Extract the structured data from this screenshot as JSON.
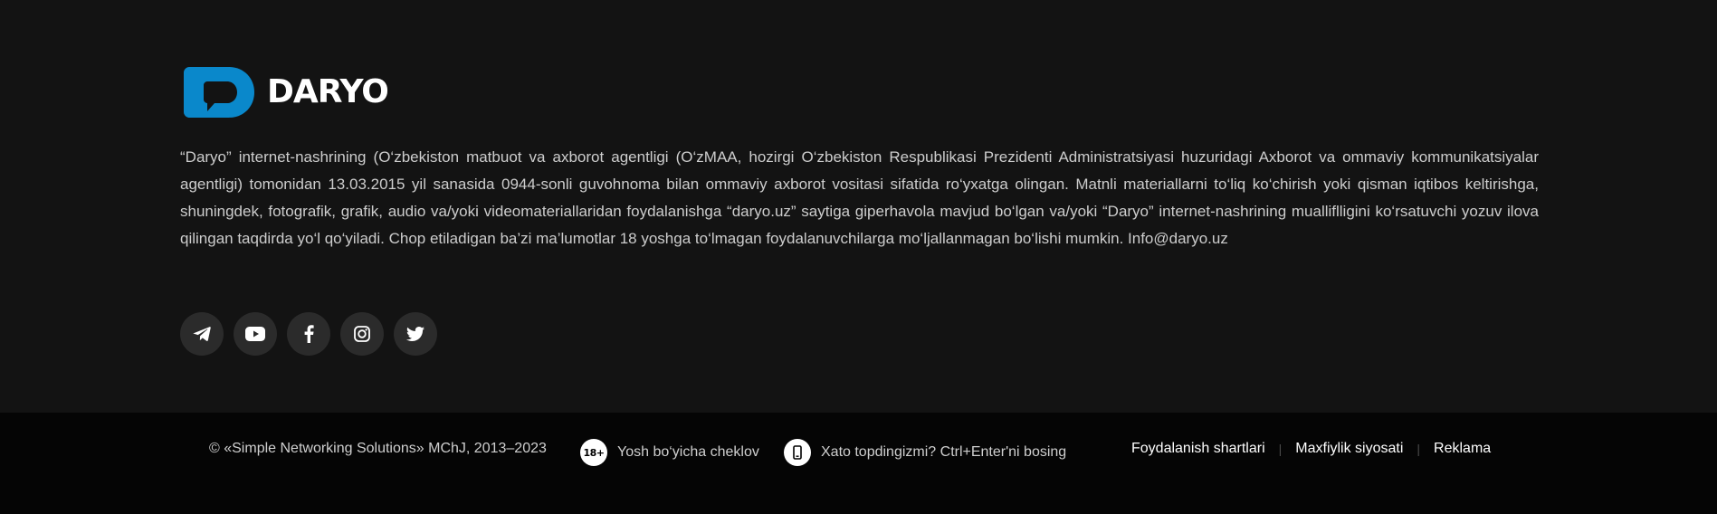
{
  "brand": {
    "name": "DARYO",
    "accent_color": "#0a88cb"
  },
  "about": {
    "text": "“Daryo” internet-nashrining (O‘zbekiston matbuot va axborot agentligi (O‘zMAA, hozirgi O‘zbekiston Respublikasi Prezidenti Administratsiyasi huzuridagi Axborot va ommaviy kommunikatsiyalar agentligi) tomonidan 13.03.2015 yil sanasida 0944-sonli guvohnoma bilan ommaviy axborot vositasi sifatida ro‘yxatga olingan. Matnli materiallarni to‘liq ko‘chirish yoki qisman iqtibos keltirishga, shuningdek, fotografik, grafik, audio va/yoki videomateriallaridan foydalanishga “daryo.uz” saytiga giperhavola mavjud bo‘lgan va/yoki “Daryo” internet-nashrining mualliflligini ko‘rsatuvchi yozuv ilova qilingan taqdirda yo‘l qo‘yiladi. Chop etiladigan ba’zi ma’lumotlar 18 yoshga to‘lmagan foydalanuvchilarga mo‘ljallanmagan bo‘lishi mumkin. Info@daryo.uz"
  },
  "socials": [
    {
      "icon": "telegram-icon"
    },
    {
      "icon": "youtube-icon"
    },
    {
      "icon": "facebook-icon"
    },
    {
      "icon": "instagram-icon"
    },
    {
      "icon": "twitter-icon"
    }
  ],
  "bottom": {
    "copyright": "© «Simple Networking Solutions» MChJ, 2013–2023",
    "age_badge": "18+",
    "age_label": "Yosh bo‘yicha cheklov",
    "error_label": "Xato topdingizmi? Ctrl+Enter'ni bosing",
    "links": [
      "Foydalanish shartlari",
      "Maxfiylik siyosati",
      "Reklama"
    ]
  }
}
